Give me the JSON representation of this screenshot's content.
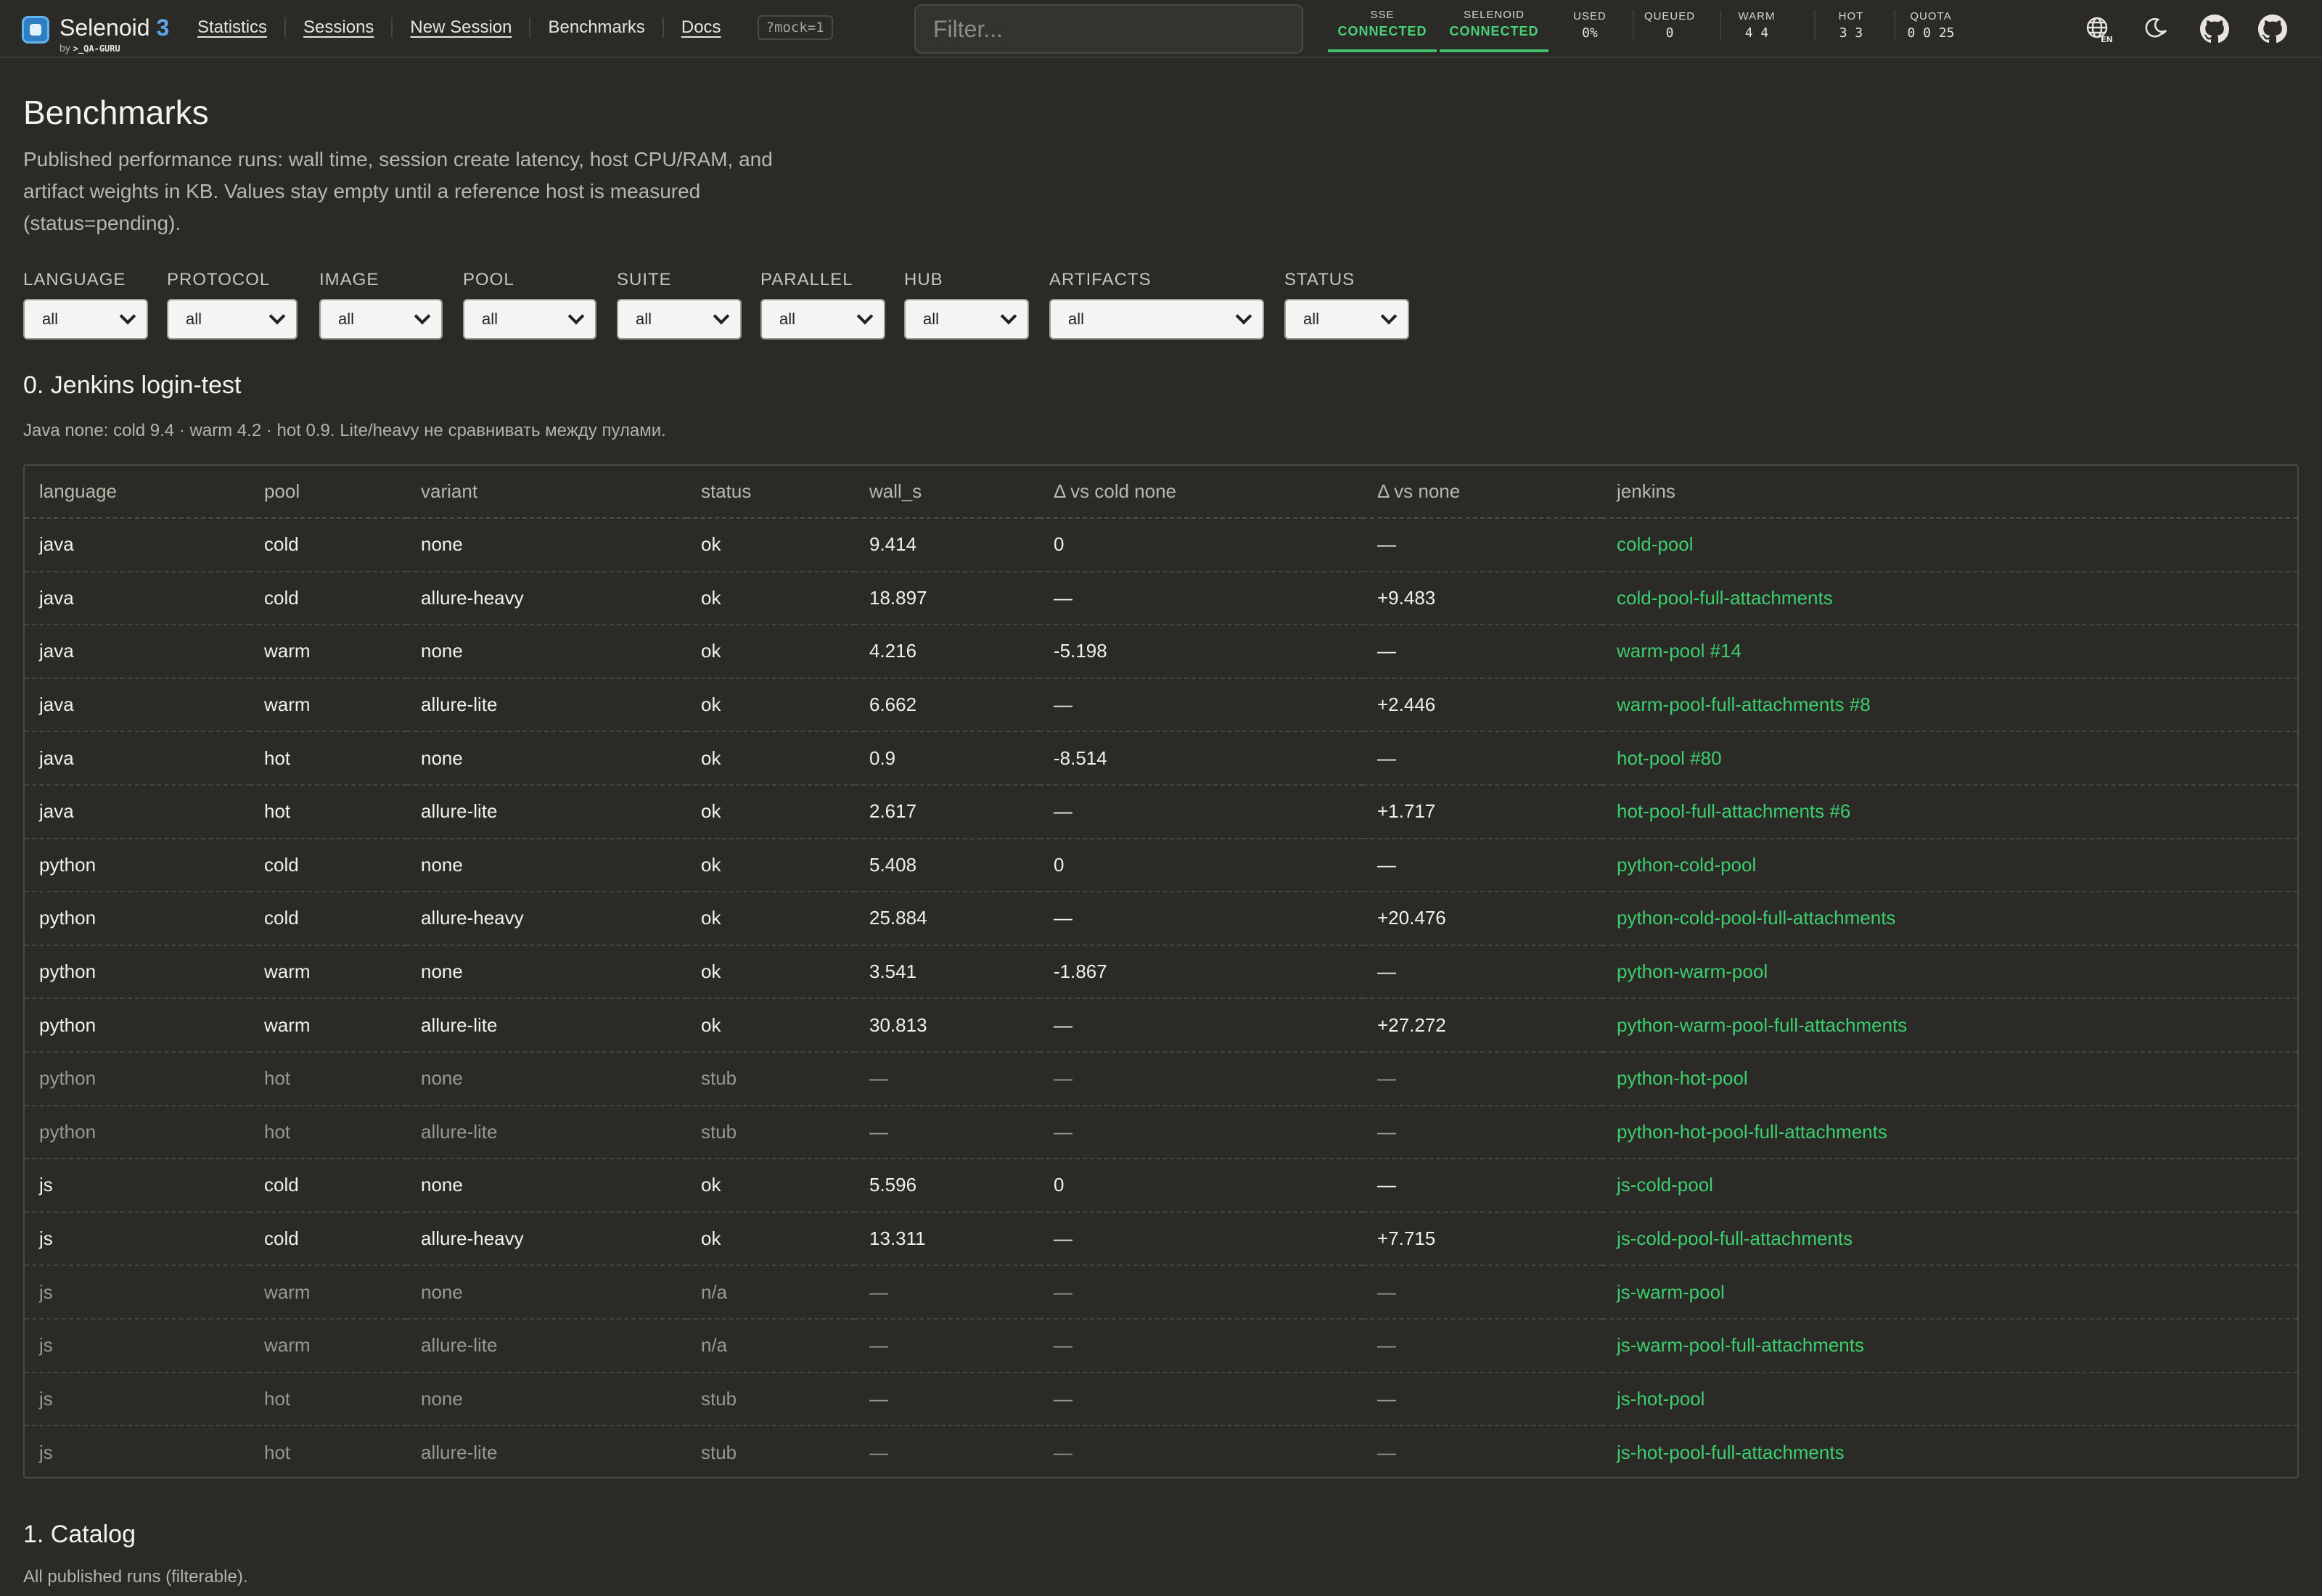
{
  "app": {
    "name": "Selenoid",
    "version": "3",
    "byline": "by",
    "brand": ">_QA-GURU"
  },
  "nav": {
    "statistics": "Statistics",
    "sessions": "Sessions",
    "new_session": "New Session",
    "benchmarks": "Benchmarks",
    "docs": "Docs",
    "mock_badge": "?mock=1"
  },
  "search": {
    "placeholder": "Filter..."
  },
  "status": {
    "sse": {
      "label": "SSE",
      "value": "CONNECTED"
    },
    "selenoid": {
      "label": "SELENOID",
      "value": "CONNECTED"
    },
    "used": {
      "label": "USED",
      "value": "0%"
    },
    "queued": {
      "label": "QUEUED",
      "value": "0"
    },
    "warm": {
      "label": "WARM",
      "value": "4 4"
    },
    "hot": {
      "label": "HOT",
      "value": "3 3"
    },
    "quota": {
      "label": "QUOTA",
      "value": "0 0 25"
    }
  },
  "icons": {
    "language": "globe-icon",
    "language_code": "EN",
    "theme": "moon-icon",
    "github1": "github-icon",
    "github2": "github-icon"
  },
  "colors": {
    "accent_green": "#3ccf6e",
    "connected_green": "#47d27a",
    "logo_blue": "#5aa9ee",
    "background": "#2b2a27"
  },
  "page": {
    "title": "Benchmarks",
    "subtitle": "Published performance runs: wall time, session create latency, host CPU/RAM, and artifact weights in KB. Values stay empty until a reference host is measured (status=pending)."
  },
  "filters": [
    {
      "label": "LANGUAGE",
      "value": "all"
    },
    {
      "label": "PROTOCOL",
      "value": "all"
    },
    {
      "label": "IMAGE",
      "value": "all"
    },
    {
      "label": "POOL",
      "value": "all"
    },
    {
      "label": "SUITE",
      "value": "all"
    },
    {
      "label": "PARALLEL",
      "value": "all"
    },
    {
      "label": "HUB",
      "value": "all"
    },
    {
      "label": "ARTIFACTS",
      "value": "all"
    },
    {
      "label": "STATUS",
      "value": "all"
    }
  ],
  "section0": {
    "title": "0. Jenkins login-test",
    "note": "Java none: cold 9.4 · warm 4.2 · hot 0.9. Lite/heavy не сравнивать между пулами."
  },
  "table": {
    "columns": [
      "language",
      "pool",
      "variant",
      "status",
      "wall_s",
      "Δ vs cold none",
      "Δ vs none",
      "jenkins"
    ],
    "rows": [
      [
        "java",
        "cold",
        "none",
        "ok",
        "9.414",
        "0",
        "—",
        "cold-pool"
      ],
      [
        "java",
        "cold",
        "allure-heavy",
        "ok",
        "18.897",
        "—",
        "+9.483",
        "cold-pool-full-attachments"
      ],
      [
        "java",
        "warm",
        "none",
        "ok",
        "4.216",
        "-5.198",
        "—",
        "warm-pool #14"
      ],
      [
        "java",
        "warm",
        "allure-lite",
        "ok",
        "6.662",
        "—",
        "+2.446",
        "warm-pool-full-attachments #8"
      ],
      [
        "java",
        "hot",
        "none",
        "ok",
        "0.9",
        "-8.514",
        "—",
        "hot-pool #80"
      ],
      [
        "java",
        "hot",
        "allure-lite",
        "ok",
        "2.617",
        "—",
        "+1.717",
        "hot-pool-full-attachments #6"
      ],
      [
        "python",
        "cold",
        "none",
        "ok",
        "5.408",
        "0",
        "—",
        "python-cold-pool"
      ],
      [
        "python",
        "cold",
        "allure-heavy",
        "ok",
        "25.884",
        "—",
        "+20.476",
        "python-cold-pool-full-attachments"
      ],
      [
        "python",
        "warm",
        "none",
        "ok",
        "3.541",
        "-1.867",
        "—",
        "python-warm-pool"
      ],
      [
        "python",
        "warm",
        "allure-lite",
        "ok",
        "30.813",
        "—",
        "+27.272",
        "python-warm-pool-full-attachments"
      ],
      [
        "python",
        "hot",
        "none",
        "stub",
        "—",
        "—",
        "—",
        "python-hot-pool"
      ],
      [
        "python",
        "hot",
        "allure-lite",
        "stub",
        "—",
        "—",
        "—",
        "python-hot-pool-full-attachments"
      ],
      [
        "js",
        "cold",
        "none",
        "ok",
        "5.596",
        "0",
        "—",
        "js-cold-pool"
      ],
      [
        "js",
        "cold",
        "allure-heavy",
        "ok",
        "13.311",
        "—",
        "+7.715",
        "js-cold-pool-full-attachments"
      ],
      [
        "js",
        "warm",
        "none",
        "n/a",
        "—",
        "—",
        "—",
        "js-warm-pool"
      ],
      [
        "js",
        "warm",
        "allure-lite",
        "n/a",
        "—",
        "—",
        "—",
        "js-warm-pool-full-attachments"
      ],
      [
        "js",
        "hot",
        "none",
        "stub",
        "—",
        "—",
        "—",
        "js-hot-pool"
      ],
      [
        "js",
        "hot",
        "allure-lite",
        "stub",
        "—",
        "—",
        "—",
        "js-hot-pool-full-attachments"
      ]
    ]
  },
  "section1": {
    "title": "1. Catalog",
    "note": "All published runs (filterable)."
  }
}
